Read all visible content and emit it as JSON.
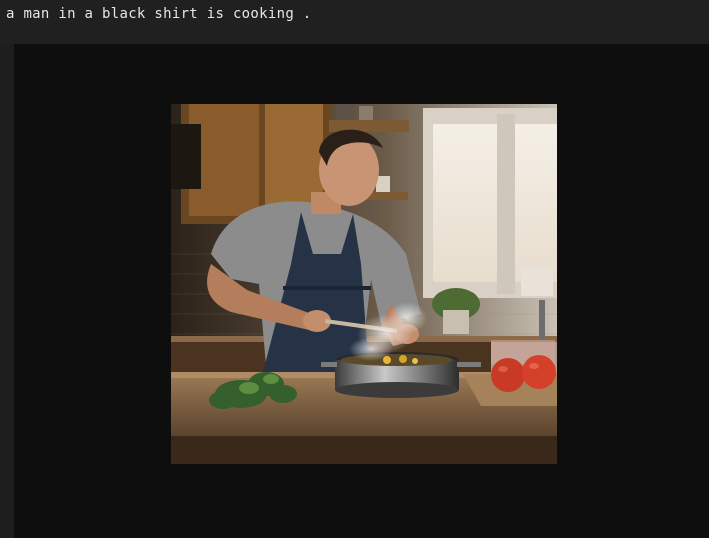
{
  "caption": {
    "text": "a man in a black shirt is cooking ."
  },
  "image": {
    "icon": "photo-icon"
  }
}
